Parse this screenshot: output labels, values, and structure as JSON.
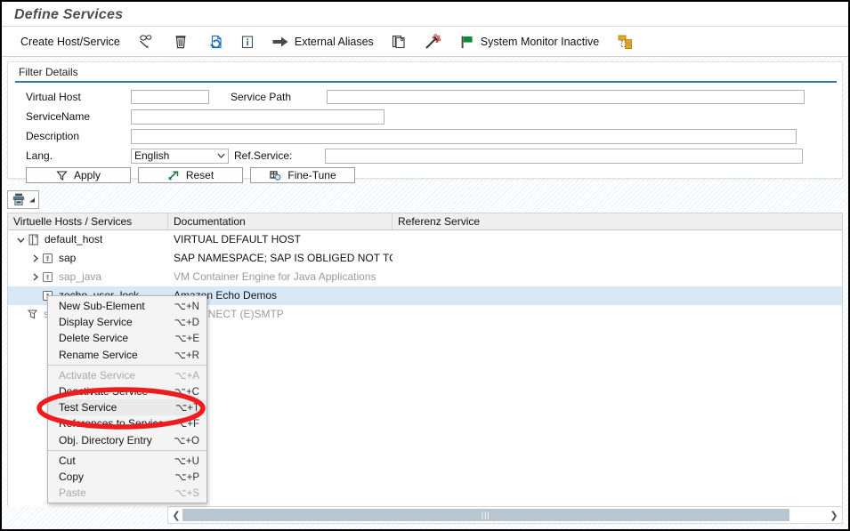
{
  "window": {
    "title": "Define Services"
  },
  "toolbar": {
    "items": [
      {
        "label": "Create Host/Service",
        "icon": "create-host-service-text"
      },
      {
        "label": "",
        "icon": "display-change-icon"
      },
      {
        "label": "",
        "icon": "trash-delete-icon"
      },
      {
        "label": "",
        "icon": "refresh-page-icon"
      },
      {
        "label": "",
        "icon": "info-icon"
      },
      {
        "label": "External Aliases",
        "icon": "arrow-right-icon"
      },
      {
        "label": "",
        "icon": "copy-pages-icon"
      },
      {
        "label": "",
        "icon": "magic-wand-icon"
      },
      {
        "label": "System Monitor Inactive",
        "icon": "green-flag-icon"
      },
      {
        "label": "",
        "icon": "hierarchy-tree-icon"
      }
    ]
  },
  "filter": {
    "title": "Filter Details",
    "virtual_host_label": "Virtual Host",
    "virtual_host_value": "",
    "service_path_label": "Service Path",
    "service_path_value": "",
    "service_name_label": "ServiceName",
    "service_name_value": "",
    "description_label": "Description",
    "description_value": "",
    "lang_label": "Lang.",
    "lang_value": "English",
    "lang_options": [
      "English"
    ],
    "ref_service_label": "Ref.Service:",
    "ref_service_value": "",
    "apply_label": "Apply",
    "reset_label": "Reset",
    "fine_tune_label": "Fine-Tune"
  },
  "tree_toolbar": {
    "print_icon": "printer-icon",
    "dropdown_icon": "corner-triangle-icon"
  },
  "table": {
    "columns": [
      "Virtuelle Hosts / Services",
      "Documentation",
      "Referenz Service"
    ],
    "rows": [
      {
        "name": "default_host",
        "doc": "VIRTUAL DEFAULT HOST",
        "ref": "",
        "indent": 0,
        "twisty": "expanded",
        "icon": "virtual-host-icon",
        "dim": false,
        "selected": false
      },
      {
        "name": "sap",
        "doc": "SAP NAMESPACE; SAP IS OBLIGED NOT TO D…",
        "ref": "",
        "indent": 1,
        "twisty": "collapsed",
        "icon": "service-node-icon",
        "dim": false,
        "selected": false
      },
      {
        "name": "sap_java",
        "doc": "VM Container Engine for Java Applications",
        "ref": "",
        "indent": 1,
        "twisty": "collapsed",
        "icon": "service-node-icon",
        "dim": true,
        "selected": false
      },
      {
        "name": "zecho_user_lock",
        "doc": "Amazon Echo Demos",
        "ref": "",
        "indent": 1,
        "twisty": "none",
        "icon": "service-node-icon",
        "dim": false,
        "selected": true
      },
      {
        "name": "s",
        "doc": "NNECT (E)SMTP",
        "ref": "",
        "indent": 0,
        "twisty": "none",
        "icon": "smtp-node-icon",
        "dim": true,
        "selected": false
      }
    ]
  },
  "context_menu": {
    "items": [
      {
        "label": "New Sub-Element",
        "shortcut": "⌥+N",
        "disabled": false,
        "separator_after": false,
        "highlight": false
      },
      {
        "label": "Display Service",
        "shortcut": "⌥+D",
        "disabled": false,
        "separator_after": false,
        "highlight": false
      },
      {
        "label": "Delete Service",
        "shortcut": "⌥+E",
        "disabled": false,
        "separator_after": false,
        "highlight": false
      },
      {
        "label": "Rename Service",
        "shortcut": "⌥+R",
        "disabled": false,
        "separator_after": true,
        "highlight": false
      },
      {
        "label": "Activate Service",
        "shortcut": "⌥+A",
        "disabled": true,
        "separator_after": false,
        "highlight": false
      },
      {
        "label": "Deactivate Service",
        "shortcut": "⌥+C",
        "disabled": false,
        "separator_after": false,
        "highlight": false
      },
      {
        "label": "Test Service",
        "shortcut": "⌥+T",
        "disabled": false,
        "separator_after": false,
        "highlight": true
      },
      {
        "label": "References to Service",
        "shortcut": "⌥+F",
        "disabled": false,
        "separator_after": false,
        "highlight": false
      },
      {
        "label": "Obj. Directory Entry",
        "shortcut": "⌥+O",
        "disabled": false,
        "separator_after": true,
        "highlight": false
      },
      {
        "label": "Cut",
        "shortcut": "⌥+U",
        "disabled": false,
        "separator_after": false,
        "highlight": false
      },
      {
        "label": "Copy",
        "shortcut": "⌥+P",
        "disabled": false,
        "separator_after": false,
        "highlight": false
      },
      {
        "label": "Paste",
        "shortcut": "⌥+S",
        "disabled": true,
        "separator_after": false,
        "highlight": false
      }
    ]
  },
  "annotation": {
    "shape": "red-ellipse-highlight",
    "color": "#ee1c1c",
    "targets": "Test Service"
  },
  "scrollbar": {
    "left_arrow": "❮",
    "right_arrow": "❯",
    "grip": "|||"
  },
  "colors": {
    "accent_blue": "#2b7ab0",
    "selection": "#d7e9f7",
    "annotation_red": "#ee1c1c",
    "flag_green": "#0a8a3c",
    "icon_blue": "#1f70b5"
  }
}
